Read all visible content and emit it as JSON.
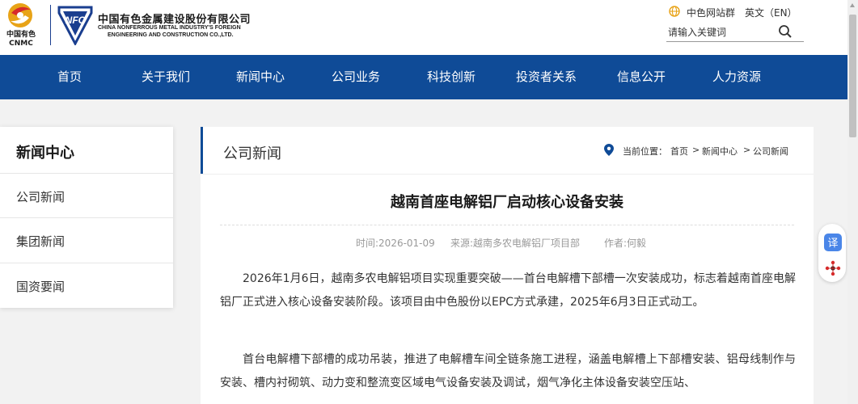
{
  "header": {
    "logo_cn": "中国有色",
    "logo_en": "CNMC",
    "company_cn": "中国有色金属建设股份有限公司",
    "company_en_line1": "CHINA NONFERROUS METAL INDUSTRY'S FOREIGN",
    "company_en_line2": "ENGINEERING AND CONSTRUCTION CO.,LTD.",
    "nfc_mark": "NFC",
    "site_group": "中色网站群",
    "language": "英文（EN）",
    "search_placeholder": "请输入关键词"
  },
  "nav": {
    "items": [
      "首页",
      "关于我们",
      "新闻中心",
      "公司业务",
      "科技创新",
      "投资者关系",
      "信息公开",
      "人力资源"
    ]
  },
  "sidebar": {
    "title": "新闻中心",
    "items": [
      "公司新闻",
      "集团新闻",
      "国资要闻"
    ]
  },
  "main": {
    "section_title": "公司新闻",
    "location_label": "当前位置：",
    "breadcrumb": [
      "首页",
      "新闻中心",
      "公司新闻"
    ],
    "breadcrumb_sep": ">"
  },
  "article": {
    "title": "越南首座电解铝厂启动核心设备安装",
    "time": "时间:2026-01-09",
    "source": "来源:越南多农电解铝厂项目部",
    "author": "作者:何毅",
    "paragraphs": [
      "2026年1月6日，越南多农电解铝项目实现重要突破——首台电解槽下部槽一次安装成功，标志着越南首座电解铝厂正式进入核心设备安装阶段。该项目由中色股份以EPC方式承建，2025年6月3日正式动工。",
      "首台电解槽下部槽的成功吊装，推进了电解槽车间全链条施工进程，涵盖电解槽上下部槽安装、铝母线制作与安装、槽内衬砌筑、动力变和整流变区域电气设备安装及调试，烟气净化主体设备安装空压站、"
    ]
  },
  "tools": {
    "translate_label": "译"
  },
  "colors": {
    "brand_blue": "#0f4b97",
    "logo_gold": "#e8a317",
    "logo_red": "#d62b2b"
  }
}
